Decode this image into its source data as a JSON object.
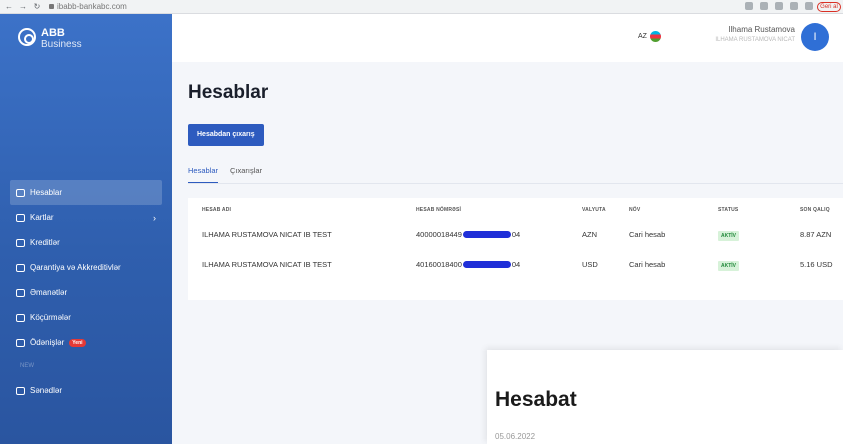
{
  "browser": {
    "url": "ibabb-bankabc.com",
    "profile_label": "Geri al",
    "nav_icons": [
      "back-icon",
      "forward-icon",
      "reload-icon"
    ]
  },
  "brand": {
    "name": "ABB",
    "sub": "Business"
  },
  "sidebar": {
    "items": [
      {
        "label": "Hesablar",
        "icon": "wallet-icon",
        "active": true
      },
      {
        "label": "Kartlar",
        "icon": "card-icon",
        "has_chevron": true
      },
      {
        "label": "Kreditlər",
        "icon": "credit-icon"
      },
      {
        "label": "Qarantiya və Akkreditivlər",
        "icon": "guarantee-icon"
      },
      {
        "label": "Əmanətlər",
        "icon": "deposit-icon"
      },
      {
        "label": "Köçürmələr",
        "icon": "transfer-icon"
      },
      {
        "label": "Ödənişlər",
        "icon": "payment-icon",
        "badge": "Yeni"
      },
      {
        "label": "Sənədlər",
        "icon": "documents-icon"
      }
    ],
    "chevron": "›",
    "gap_label": "NEW"
  },
  "header": {
    "language": "AZ",
    "user_name": "Ilhama Rustamova",
    "company": "ILHAMA RUSTAMOVA NICAT",
    "avatar_initial": "I"
  },
  "main": {
    "title": "Hesablar",
    "primary_button": "Hesabdan çıxarış",
    "tabs": [
      "Hesablar",
      "Çıxarışlar"
    ],
    "table": {
      "headers": [
        "HESAB ADI",
        "HESAB NÖMRƏSİ",
        "VALYUTA",
        "NÖV",
        "STATUS",
        "SON QALIQ"
      ],
      "rows": [
        {
          "name": "ILHAMA RUSTAMOVA NICAT IB TEST",
          "number_prefix": "40000018449",
          "number_suffix": "04",
          "currency": "AZN",
          "type": "Cari hesab",
          "status": "AKTİV",
          "balance": "8.87 AZN"
        },
        {
          "name": "ILHAMA RUSTAMOVA NICAT IB TEST",
          "number_prefix": "40160018400",
          "number_suffix": "04",
          "currency": "USD",
          "type": "Cari hesab",
          "status": "AKTİV",
          "balance": "5.16 USD"
        }
      ]
    }
  },
  "overlay": {
    "title": "Hesabat",
    "date": "05.06.2022"
  },
  "colors": {
    "sidebar": "#3366bb",
    "primary": "#2d5bbf",
    "status_bg": "#d7f2d9",
    "status_text": "#21883a"
  }
}
